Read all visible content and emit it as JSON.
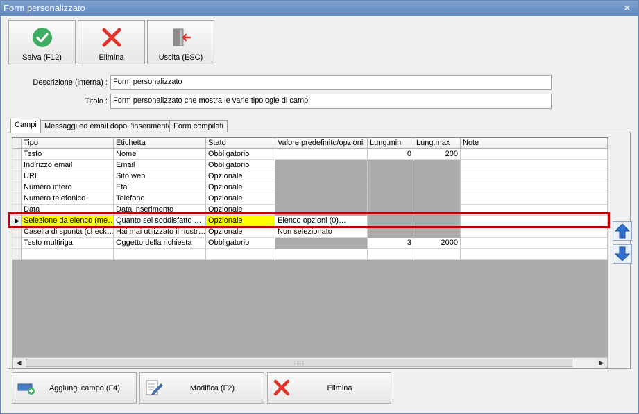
{
  "window": {
    "title": "Form personalizzato"
  },
  "toolbar": {
    "save_label": "Salva (F12)",
    "delete_label": "Elimina",
    "exit_label": "Uscita (ESC)"
  },
  "form": {
    "descrizione_label": "Descrizione (interna) :",
    "descrizione_value": "Form personalizzato",
    "titolo_label": "Titolo :",
    "titolo_value": "Form personalizzato che mostra le varie tipologie di campi"
  },
  "tabs": [
    {
      "label": "Campi"
    },
    {
      "label": "Messaggi ed email dopo l'inserimento"
    },
    {
      "label": "Form compilati"
    }
  ],
  "grid": {
    "columns": [
      "Tipo",
      "Etichetta",
      "Stato",
      "Valore predefinito/opzioni",
      "Lung.min",
      "Lung.max",
      "Note"
    ],
    "rows": [
      {
        "tipo": "Testo",
        "etichetta": "Nome",
        "stato": "Obbligatorio",
        "valore": "",
        "min": "0",
        "max": "200",
        "note": ""
      },
      {
        "tipo": "Indirizzo email",
        "etichetta": "Email",
        "stato": "Obbligatorio",
        "valore": "",
        "min": "",
        "max": "",
        "note": ""
      },
      {
        "tipo": "URL",
        "etichetta": "Sito web",
        "stato": "Opzionale",
        "valore": "",
        "min": "",
        "max": "",
        "note": ""
      },
      {
        "tipo": "Numero intero",
        "etichetta": "Eta'",
        "stato": "Opzionale",
        "valore": "",
        "min": "",
        "max": "",
        "note": ""
      },
      {
        "tipo": "Numero telefonico",
        "etichetta": "Telefono",
        "stato": "Opzionale",
        "valore": "",
        "min": "",
        "max": "",
        "note": ""
      },
      {
        "tipo": "Data",
        "etichetta": "Data inserimento",
        "stato": "Opzionale",
        "valore": "",
        "min": "",
        "max": "",
        "note": ""
      },
      {
        "tipo": "Selezione da elenco (me…",
        "etichetta": "Quanto sei soddisfatto …",
        "stato": "Opzionale",
        "valore": "Elenco opzioni (0)…",
        "min": "",
        "max": "",
        "note": ""
      },
      {
        "tipo": "Casella di spunta (check…",
        "etichetta": "Hai mai utilizzato il nostr…",
        "stato": "Opzionale",
        "valore": "Non selezionato",
        "min": "",
        "max": "",
        "note": ""
      },
      {
        "tipo": "Testo multiriga",
        "etichetta": "Oggetto della richiesta",
        "stato": "Obbligatorio",
        "valore": "",
        "min": "3",
        "max": "2000",
        "note": ""
      }
    ],
    "selected_row": 6
  },
  "bottom_buttons": {
    "add_label": "Aggiungi campo (F4)",
    "edit_label": "Modifica (F2)",
    "delete_label": "Elimina"
  },
  "colors": {
    "selection_border": "#c00000",
    "highlight": "#ffff00",
    "disabled_cell": "#ababab",
    "accent_blue": "#2f6fd0"
  }
}
